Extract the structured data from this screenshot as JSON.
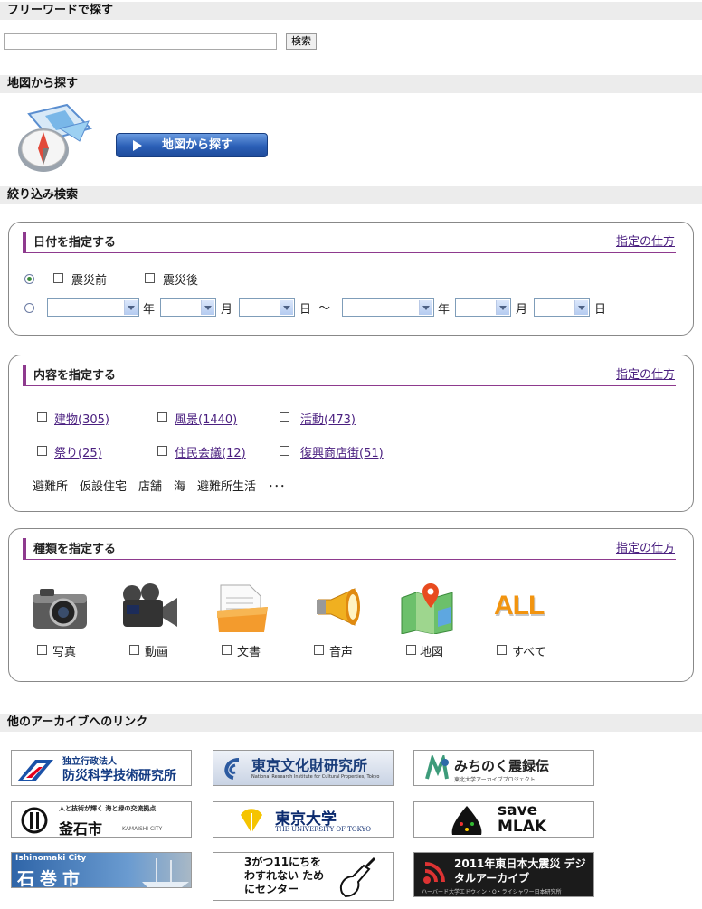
{
  "freeword": {
    "header": "フリーワードで探す",
    "input_value": "",
    "button": "検索"
  },
  "mapsearch": {
    "header": "地図から探す",
    "button": "地図から探す"
  },
  "filter": {
    "header": "絞り込み検索"
  },
  "date_panel": {
    "title": "日付を指定する",
    "howto": "指定の仕方",
    "before_label": "震災前",
    "after_label": "震災後",
    "year": "年",
    "month": "月",
    "day": "日",
    "tilde": "～"
  },
  "content_panel": {
    "title": "内容を指定する",
    "howto": "指定の仕方",
    "items": [
      "建物(305)",
      "風景(1440)",
      "活動(473)",
      "祭り(25)",
      "住民会議(12)",
      "復興商店街(51)"
    ],
    "tags": "避難所　仮設住宅　店舗　海　避難所生活　･･･"
  },
  "type_panel": {
    "title": "種類を指定する",
    "howto": "指定の仕方",
    "items": [
      "写真",
      "動画",
      "文書",
      "音声",
      "地図",
      "すべて"
    ],
    "all_icon_text": "ALL"
  },
  "links": {
    "header": "他のアーカイブへのリンク",
    "logos": [
      {
        "main": "防災科学技術研究所",
        "sub": "独立行政法人"
      },
      {
        "main": "東京文化財研究所",
        "sub": "National Research Institute for Cultural Properties, Tokyo"
      },
      {
        "main": "みちのく震録伝",
        "sub": "東北大学アーカイブプロジェクト"
      },
      {
        "main": "釜石市",
        "sub": "人と技術が輝く 海と緑の交流拠点",
        "extra": "KAMAISHI CITY"
      },
      {
        "main": "東京大学",
        "sub": "THE UNIVERSITY OF TOKYO"
      },
      {
        "main": "save MLAK"
      },
      {
        "main": "石巻市",
        "sub": "Ishinomaki City"
      },
      {
        "main": "3がつ11にちを わすれない ためにセンター"
      },
      {
        "main": "2011年東日本大震災 デジタルアーカイブ",
        "sub": "ハーバード大学エドウィン・O・ライシャワー日本研究所"
      }
    ]
  },
  "colors": {
    "accent": "#8e3a8e",
    "header_bg": "#ececec",
    "link": "#4b2080"
  }
}
